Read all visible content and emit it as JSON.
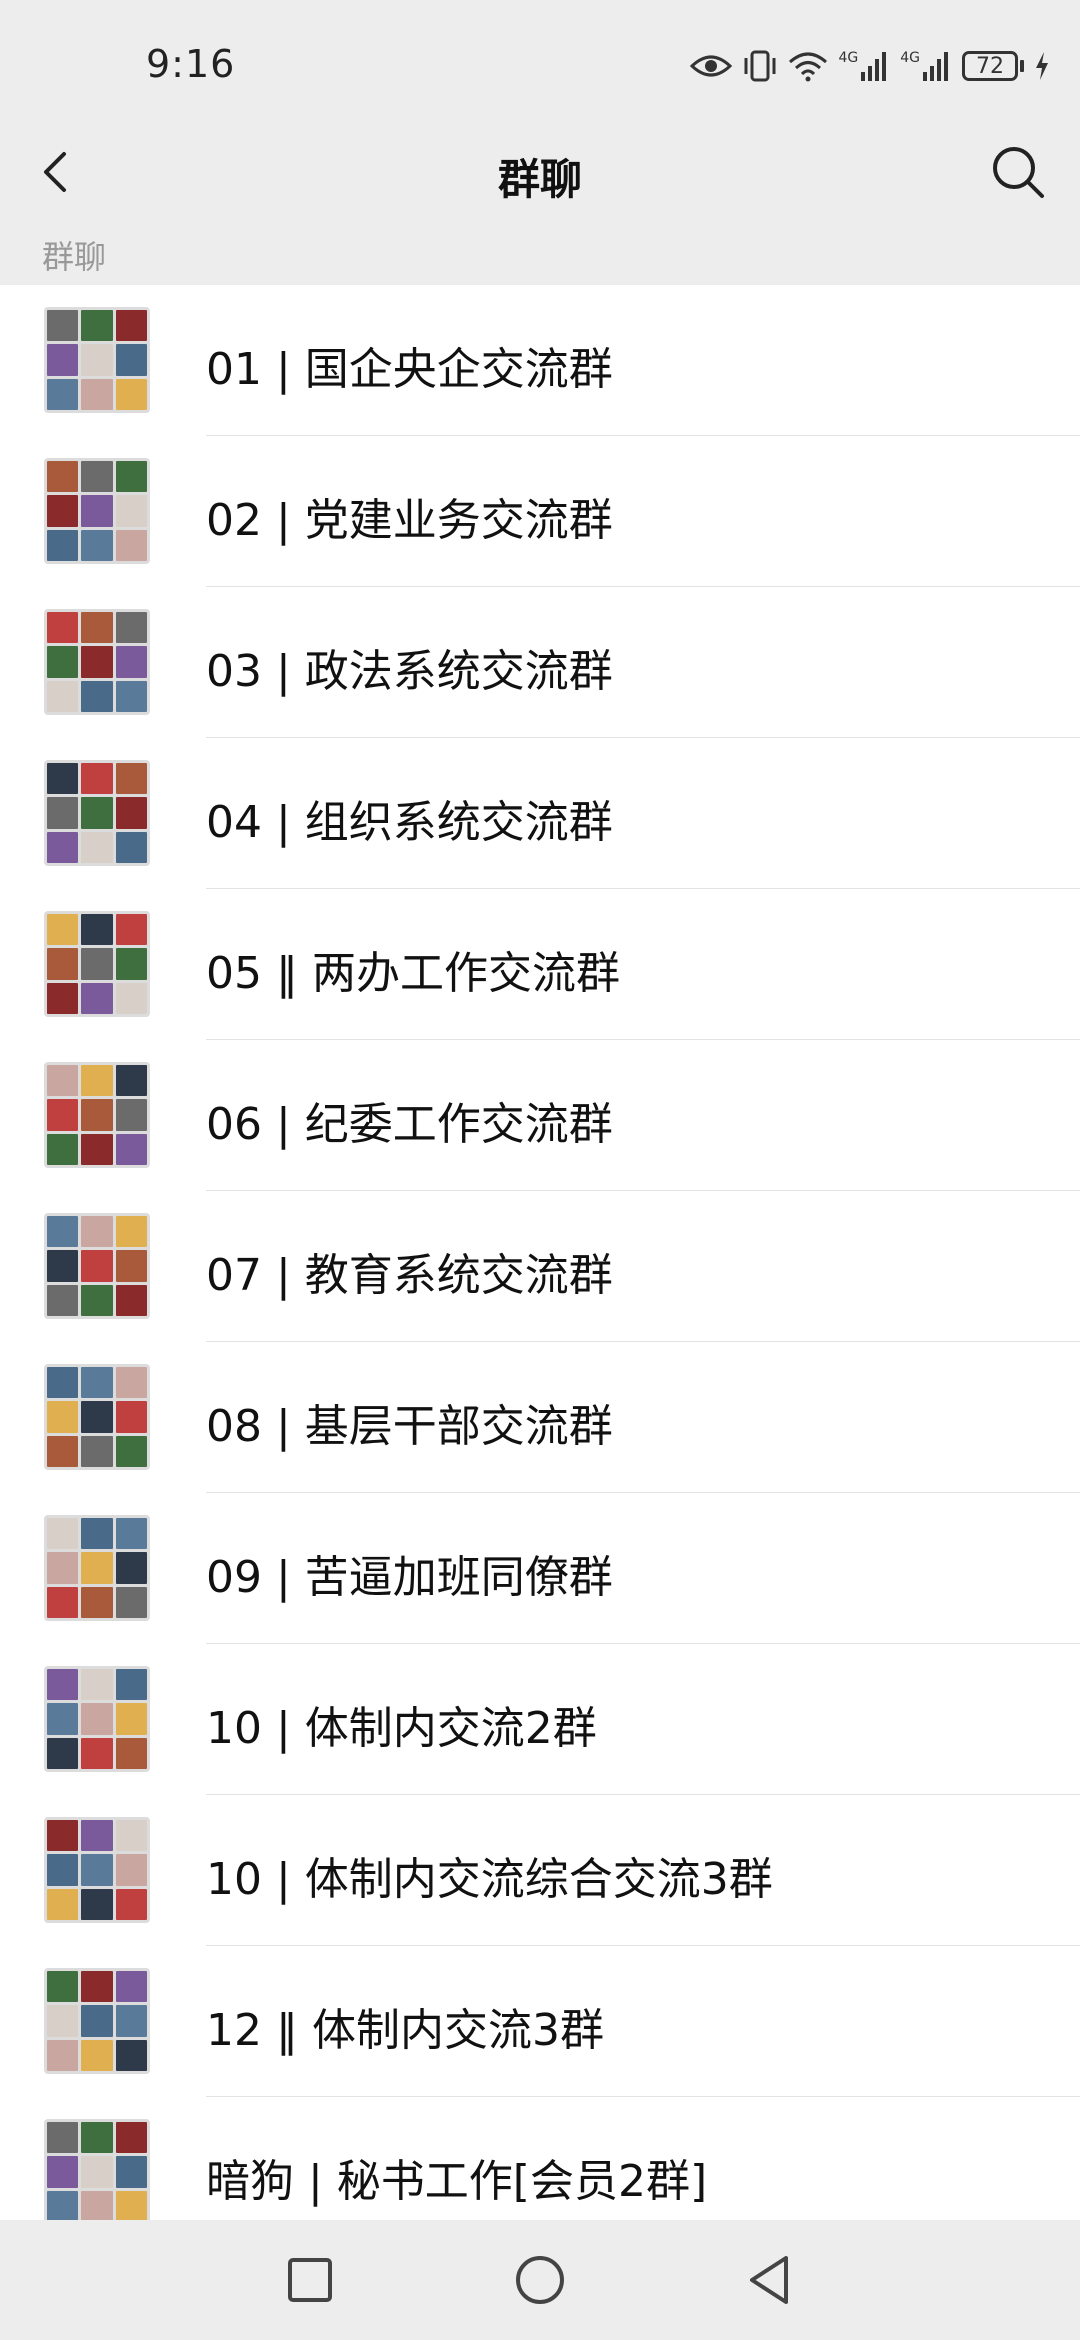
{
  "status_bar": {
    "time": "9:16",
    "battery": "72",
    "network_1": "4G",
    "network_2": "4G",
    "icons": [
      "eye-icon",
      "vibrate-icon",
      "wifi-icon",
      "signal-icon",
      "signal-icon",
      "battery-icon",
      "charging-icon"
    ]
  },
  "header": {
    "title": "群聊",
    "back_icon": "chevron-left-icon",
    "search_icon": "search-icon"
  },
  "section": {
    "label": "群聊"
  },
  "groups": [
    {
      "name": "01 | 国企央企交流群"
    },
    {
      "name": "02 | 党建业务交流群"
    },
    {
      "name": "03 | 政法系统交流群"
    },
    {
      "name": "04 | 组织系统交流群"
    },
    {
      "name": "05 ‖ 两办工作交流群"
    },
    {
      "name": "06 | 纪委工作交流群"
    },
    {
      "name": "07 | 教育系统交流群"
    },
    {
      "name": "08 | 基层干部交流群"
    },
    {
      "name": "09 | 苦逼加班同僚群"
    },
    {
      "name": "10 | 体制内交流2群"
    },
    {
      "name": "10 | 体制内交流综合交流3群"
    },
    {
      "name": "12 ‖ 体制内交流3群"
    },
    {
      "name": "暗狗 | 秘书工作[会员2群]"
    }
  ],
  "bottom_nav": {
    "icons": [
      "recents-square-icon",
      "home-circle-icon",
      "back-triangle-icon"
    ]
  },
  "colors": {
    "background": "#ededed",
    "list_background": "#ffffff",
    "section_text": "#999999"
  }
}
